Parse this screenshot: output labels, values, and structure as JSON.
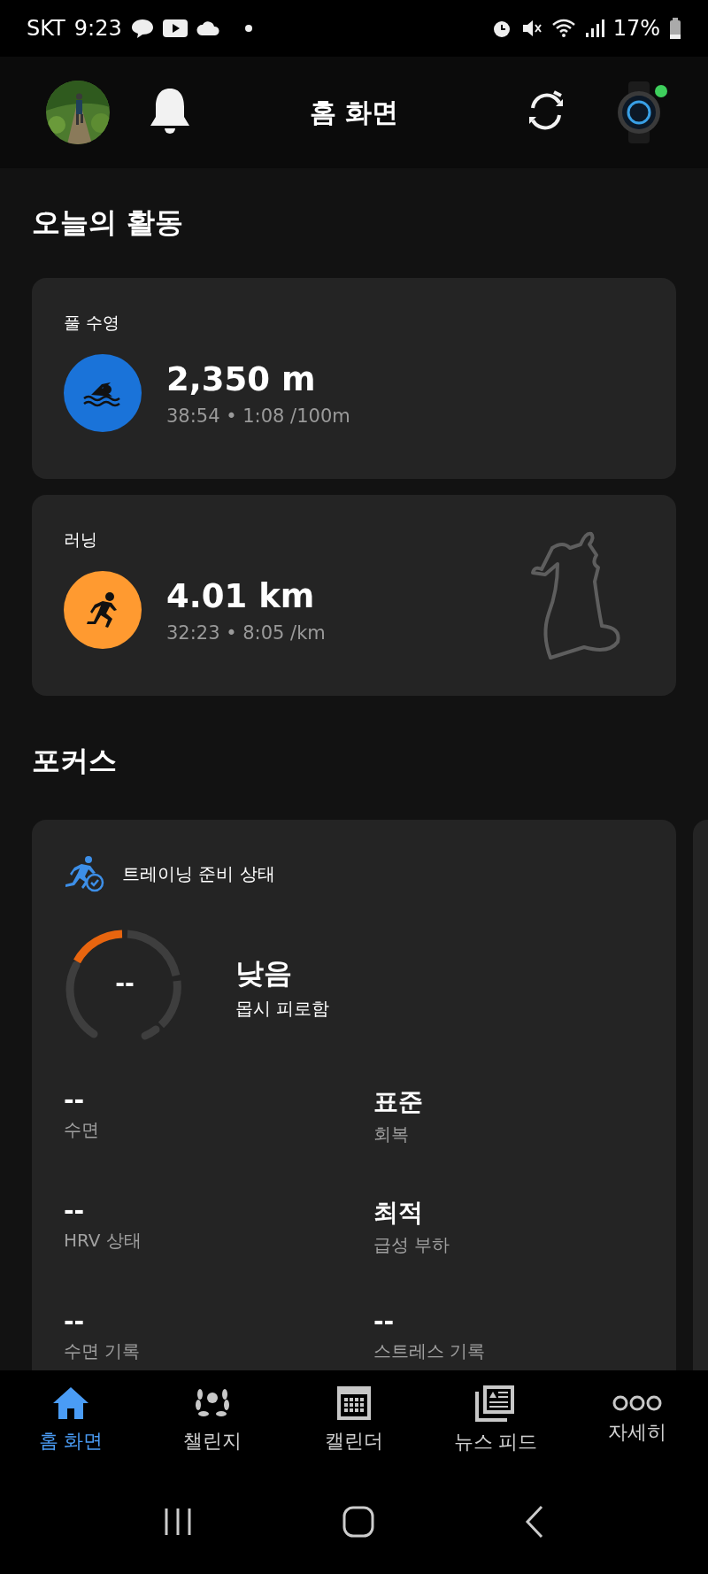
{
  "status_bar": {
    "carrier": "SKT",
    "time": "9:23",
    "battery": "17%"
  },
  "header": {
    "title": "홈 화면",
    "watch": {
      "connected": true
    }
  },
  "today": {
    "title": "오늘의 활동",
    "activities": [
      {
        "kind": "swim",
        "label": "풀 수영",
        "value": "2,350 m",
        "detail": "38:54 • 1:08 /100m",
        "color": "#1a73d9"
      },
      {
        "kind": "run",
        "label": "러닝",
        "value": "4.01 km",
        "detail": "32:23 • 8:05 /km",
        "color": "#ff9a30",
        "route": true
      }
    ]
  },
  "focus": {
    "title": "포커스",
    "card": {
      "title": "트레이닝 준비 상태",
      "gauge_value": "--",
      "status": "낮음",
      "status_note": "몹시 피로함",
      "metrics": [
        {
          "value": "--",
          "label": "수면"
        },
        {
          "value": "표준",
          "label": "회복"
        },
        {
          "value": "--",
          "label": "HRV 상태"
        },
        {
          "value": "최적",
          "label": "급성 부하"
        },
        {
          "value": "--",
          "label": "수면 기록"
        },
        {
          "value": "--",
          "label": "스트레스 기록"
        }
      ]
    }
  },
  "nav": [
    {
      "kind": "home",
      "label": "홈 화면",
      "selected": true
    },
    {
      "kind": "challenge",
      "label": "챌린지",
      "selected": false
    },
    {
      "kind": "calendar",
      "label": "캘린더",
      "selected": false
    },
    {
      "kind": "news",
      "label": "뉴스 피드",
      "selected": false
    },
    {
      "kind": "more",
      "label": "자세히",
      "selected": false
    }
  ]
}
